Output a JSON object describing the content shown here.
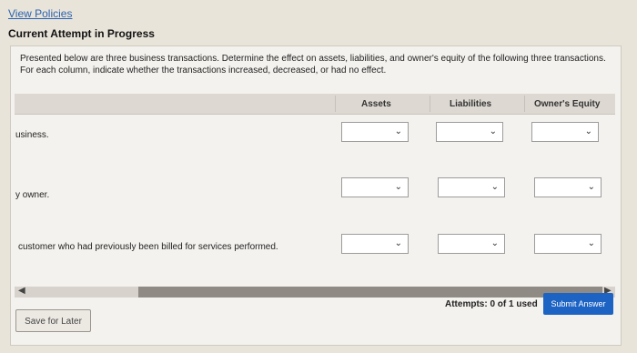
{
  "header": {
    "view_policies": "View Policies",
    "attempt_title": "Current Attempt in Progress"
  },
  "instructions": "Presented below are three business transactions. Determine the effect on assets, liabilities, and owner's equity of the following three transactions. For each column, indicate whether the transactions increased, decreased, or had no effect.",
  "table": {
    "columns": [
      "Assets",
      "Liabilities",
      "Owner's Equity"
    ],
    "rows": [
      {
        "label": "usiness.",
        "values": [
          "",
          "",
          ""
        ]
      },
      {
        "label": "y owner.",
        "values": [
          "",
          "",
          ""
        ]
      },
      {
        "label": "customer who had previously been billed for services performed.",
        "values": [
          "",
          "",
          ""
        ]
      }
    ]
  },
  "footer": {
    "attempts": "Attempts: 0 of 1 used",
    "submit_label": "Submit Answer",
    "save_label": "Save for Later"
  },
  "icons": {
    "dropdown": "chevron-down-icon",
    "scroll_left": "scroll-left-arrow-icon",
    "scroll_right": "scroll-right-arrow-icon"
  },
  "colors": {
    "link": "#2a63b0",
    "submit_bg": "#1d63c4"
  }
}
